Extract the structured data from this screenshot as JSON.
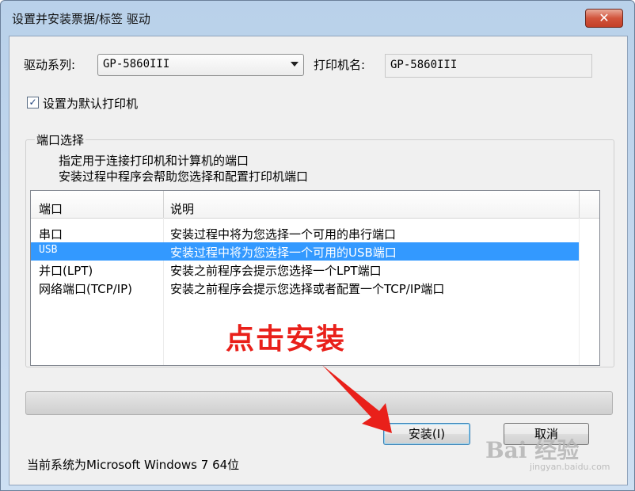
{
  "window": {
    "title": "设置并安装票据/标签 驱动",
    "close_symbol": "✕"
  },
  "form": {
    "driver_series_label": "驱动系列:",
    "driver_series_value": "GP-5860III",
    "printer_name_label": "打印机名:",
    "printer_name_value": "GP-5860III",
    "default_printer_checked": true,
    "default_printer_label": "设置为默认打印机"
  },
  "port_group": {
    "title": "端口选择",
    "description_line1": "指定用于连接打印机和计算机的端口",
    "description_line2": "安装过程中程序会帮助您选择和配置打印机端口",
    "columns": [
      "端口",
      "说明"
    ],
    "rows": [
      {
        "port": "串口",
        "description": "安装过程中将为您选择一个可用的串行端口",
        "selected": false
      },
      {
        "port": "USB",
        "description": "安装过程中将为您选择一个可用的USB端口",
        "selected": true
      },
      {
        "port": "并口(LPT)",
        "description": "安装之前程序会提示您选择一个LPT端口",
        "selected": false
      },
      {
        "port": "网络端口(TCP/IP)",
        "description": "安装之前程序会提示您选择或者配置一个TCP/IP端口",
        "selected": false
      }
    ]
  },
  "progress": {
    "value": 0
  },
  "buttons": {
    "install": "安装(I)",
    "cancel": "取消"
  },
  "status_text": "当前系统为Microsoft Windows 7  64位",
  "annotation": {
    "text": "点击安装",
    "color": "#e9201a"
  },
  "watermark": {
    "brand": "Bai 经验",
    "url": "jingyan.baidu.com"
  },
  "colors": {
    "selection": "#3399ff",
    "accent": "#3c7fb1"
  }
}
